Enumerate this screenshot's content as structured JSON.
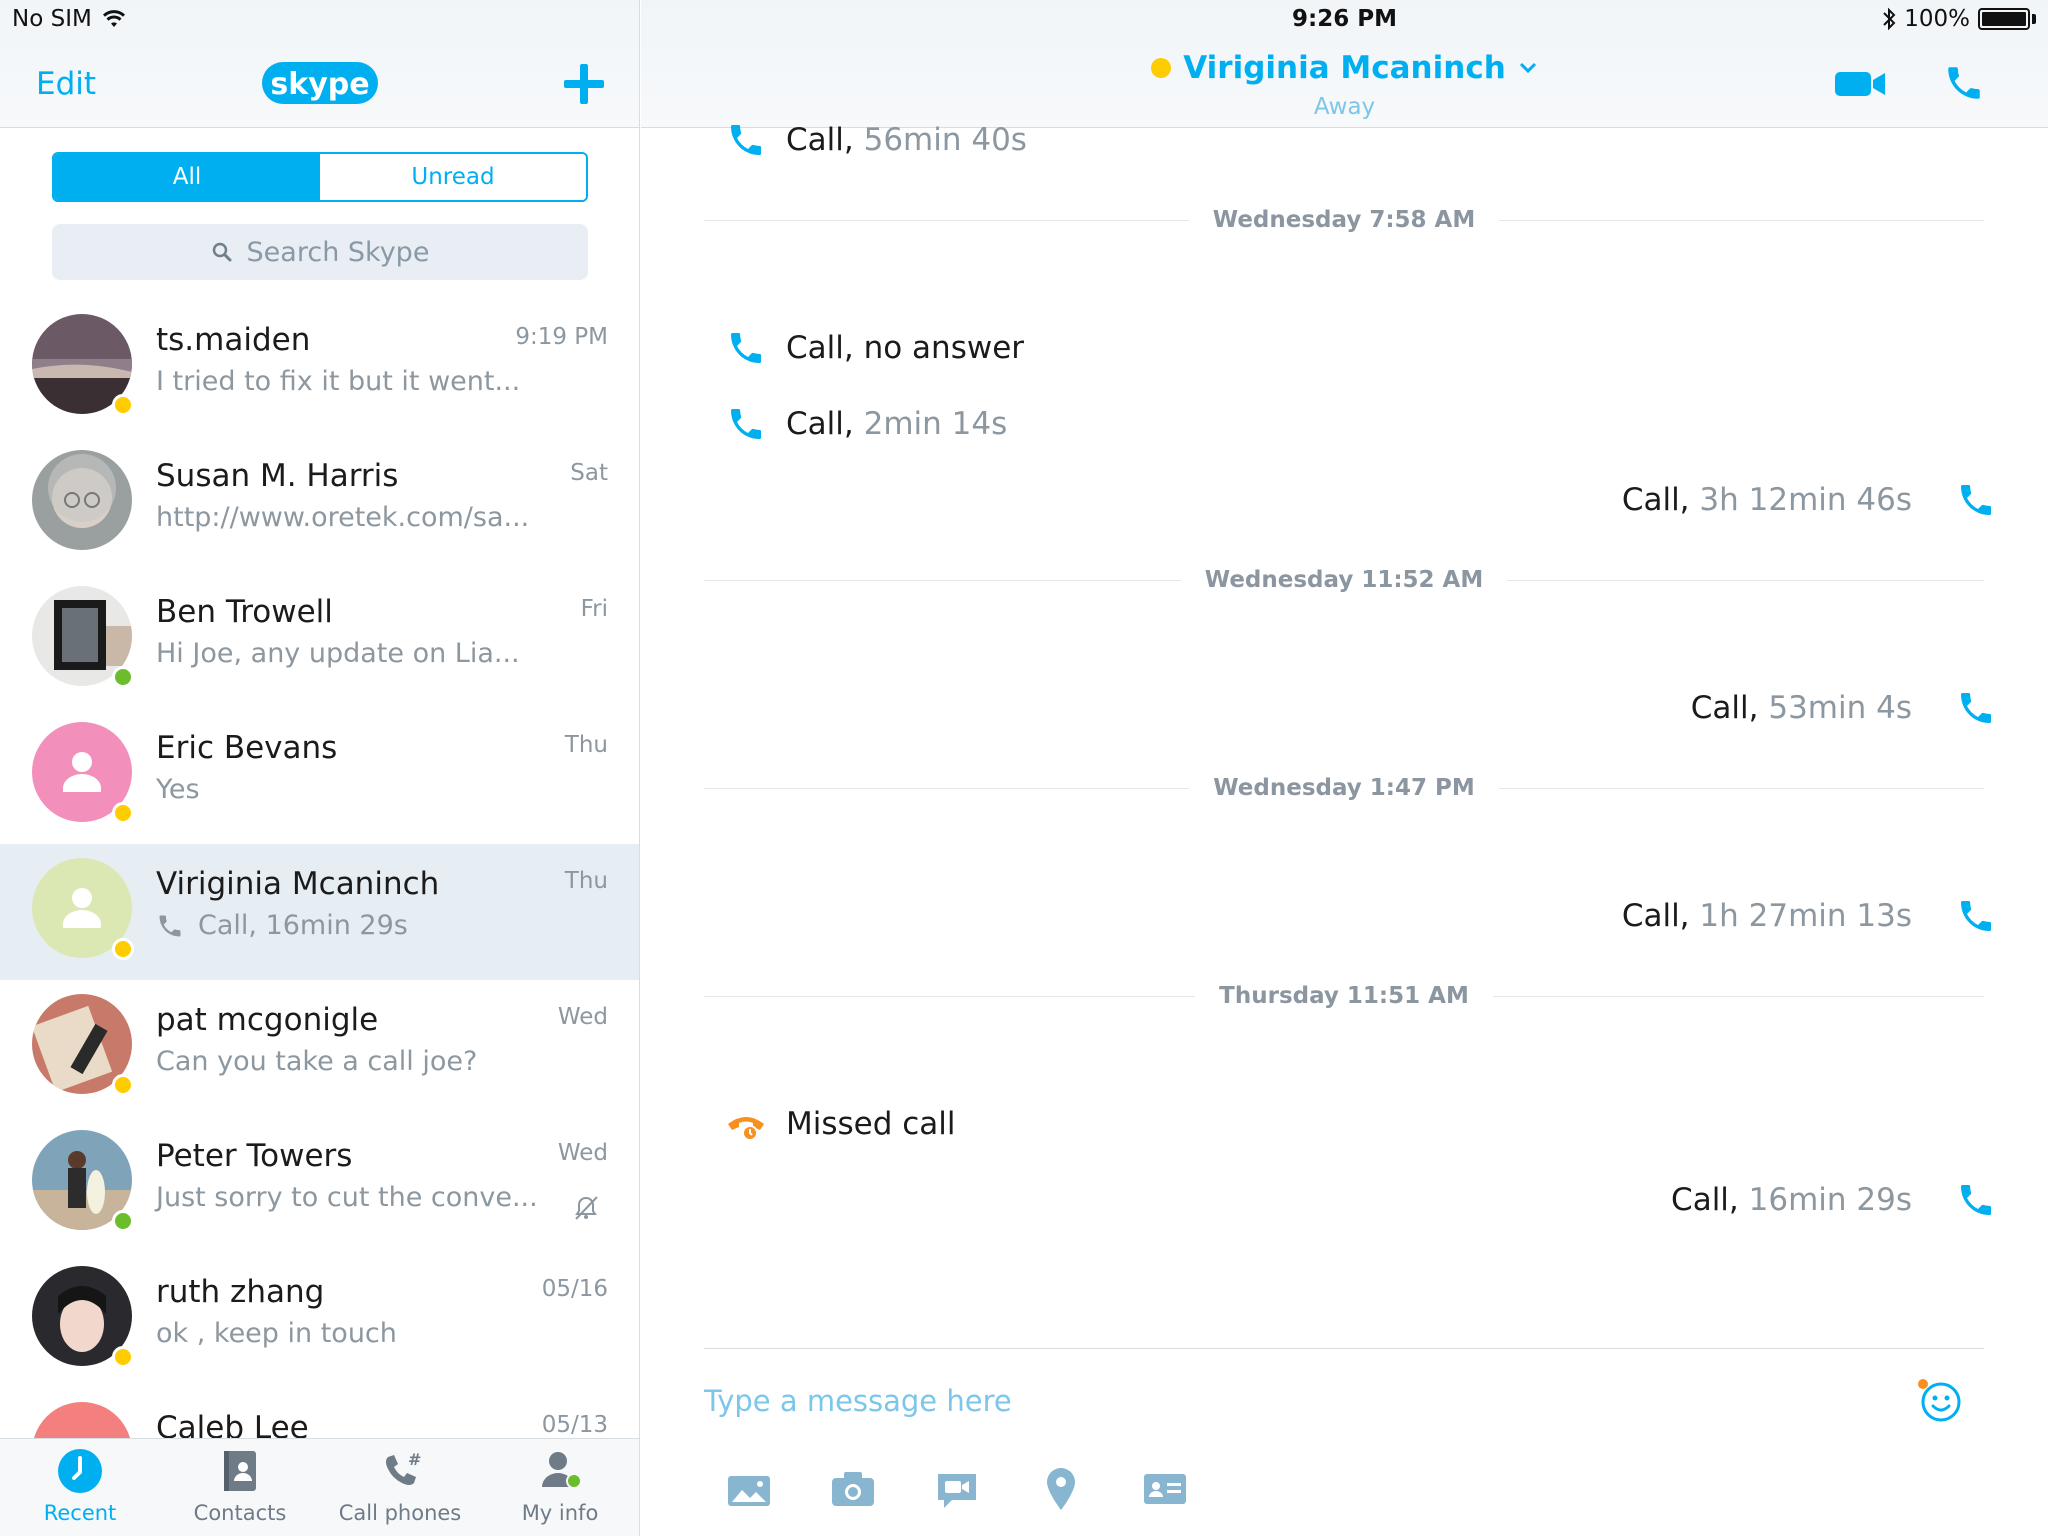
{
  "status_bar": {
    "carrier": "No SIM",
    "time": "9:26 PM",
    "battery": "100%"
  },
  "left_header": {
    "edit": "Edit",
    "logo": "skype"
  },
  "filter": {
    "all": "All",
    "unread": "Unread"
  },
  "search": {
    "placeholder": "Search Skype"
  },
  "conversations": [
    {
      "name": "ts.maiden",
      "preview": "I tried to fix it but it went...",
      "time": "9:19 PM",
      "presence": "away"
    },
    {
      "name": "Susan M. Harris",
      "preview": "http://www.oretek.com/sa...",
      "time": "Sat",
      "presence": "none"
    },
    {
      "name": "Ben Trowell",
      "preview": "Hi Joe, any update on Lia...",
      "time": "Fri",
      "presence": "online"
    },
    {
      "name": "Eric Bevans",
      "preview": "Yes",
      "time": "Thu",
      "presence": "away"
    },
    {
      "name": "Viriginia Mcaninch",
      "preview": "Call, 16min 29s",
      "time": "Thu",
      "presence": "away",
      "selected": true
    },
    {
      "name": "pat mcgonigle",
      "preview": "Can you take a call joe?",
      "time": "Wed",
      "presence": "away"
    },
    {
      "name": "Peter Towers",
      "preview": "Just sorry to cut the conve...",
      "time": "Wed",
      "presence": "online",
      "muted": true
    },
    {
      "name": "ruth zhang",
      "preview": "ok ,  keep  in  touch",
      "time": "05/16",
      "presence": "away"
    },
    {
      "name": "Caleb Lee",
      "preview": "",
      "time": "05/13",
      "presence": "none"
    }
  ],
  "tabs": {
    "recent": "Recent",
    "contacts": "Contacts",
    "call_phones": "Call phones",
    "my_info": "My info"
  },
  "chat_header": {
    "name": "Viriginia Mcaninch",
    "status": "Away"
  },
  "messages": {
    "m0": {
      "label": "Call,",
      "dur": "56min 40s"
    },
    "d1": "Wednesday 7:58 AM",
    "m1": {
      "label": "Call, no answer"
    },
    "m2": {
      "label": "Call,",
      "dur": "2min 14s"
    },
    "m3": {
      "label": "Call,",
      "dur": "3h 12min 46s"
    },
    "d2": "Wednesday 11:52 AM",
    "m4": {
      "label": "Call,",
      "dur": "53min 4s"
    },
    "d3": "Wednesday 1:47 PM",
    "m5": {
      "label": "Call,",
      "dur": "1h 27min 13s"
    },
    "d4": "Thursday 11:51 AM",
    "m6": {
      "label": "Missed call"
    },
    "m7": {
      "label": "Call,",
      "dur": "16min 29s"
    }
  },
  "composer": {
    "placeholder": "Type a message here"
  },
  "colors": {
    "accent": "#00aff0",
    "away": "#ffcc00",
    "online": "#6cbd2c",
    "missed": "#f7901e"
  }
}
